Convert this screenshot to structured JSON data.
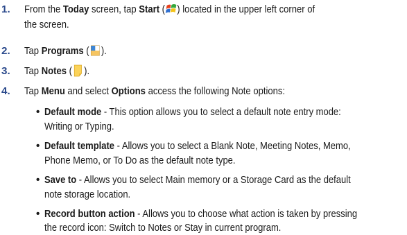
{
  "steps": [
    {
      "number": "1.",
      "line1": {
        "pre": "From the ",
        "b1": "Today",
        "mid": " screen, tap ",
        "b2": "Start",
        "open": " (",
        "icon": "windows-start-icon",
        "close": ") located in the upper left corner of"
      },
      "line2": "the screen."
    },
    {
      "number": "2.",
      "pre": "Tap ",
      "bold": "Programs",
      "open": " (",
      "icon": "programs-icon",
      "close": ")."
    },
    {
      "number": "3.",
      "pre": "Tap ",
      "bold": "Notes",
      "open": " (",
      "icon": "notes-icon",
      "close": ")."
    },
    {
      "number": "4.",
      "pre": "Tap ",
      "b1": "Menu",
      "mid": " and select ",
      "b2": "Options",
      "post": " access the following Note options:"
    }
  ],
  "options": [
    {
      "dot": "•",
      "title": "Default mode",
      "text1": " - This option allows you to select a default note entry mode:",
      "text2": "Writing or Typing."
    },
    {
      "dot": "•",
      "title": "Default template",
      "text1": " - Allows you to select a Blank Note, Meeting Notes, Memo,",
      "text2": "Phone Memo, or To Do as the default note type."
    },
    {
      "dot": "•",
      "title": "Save to",
      "text1": " - Allows you to select Main memory or a Storage Card as the default",
      "text2": "note storage location."
    },
    {
      "dot": "•",
      "title": "Record button action",
      "text1": " - Allows you to choose what action is taken by pressing",
      "text2": "the record icon: Switch to Notes or Stay in current program."
    }
  ],
  "colors": {
    "number": "#2b4a8c",
    "text": "#1a1a1a"
  }
}
